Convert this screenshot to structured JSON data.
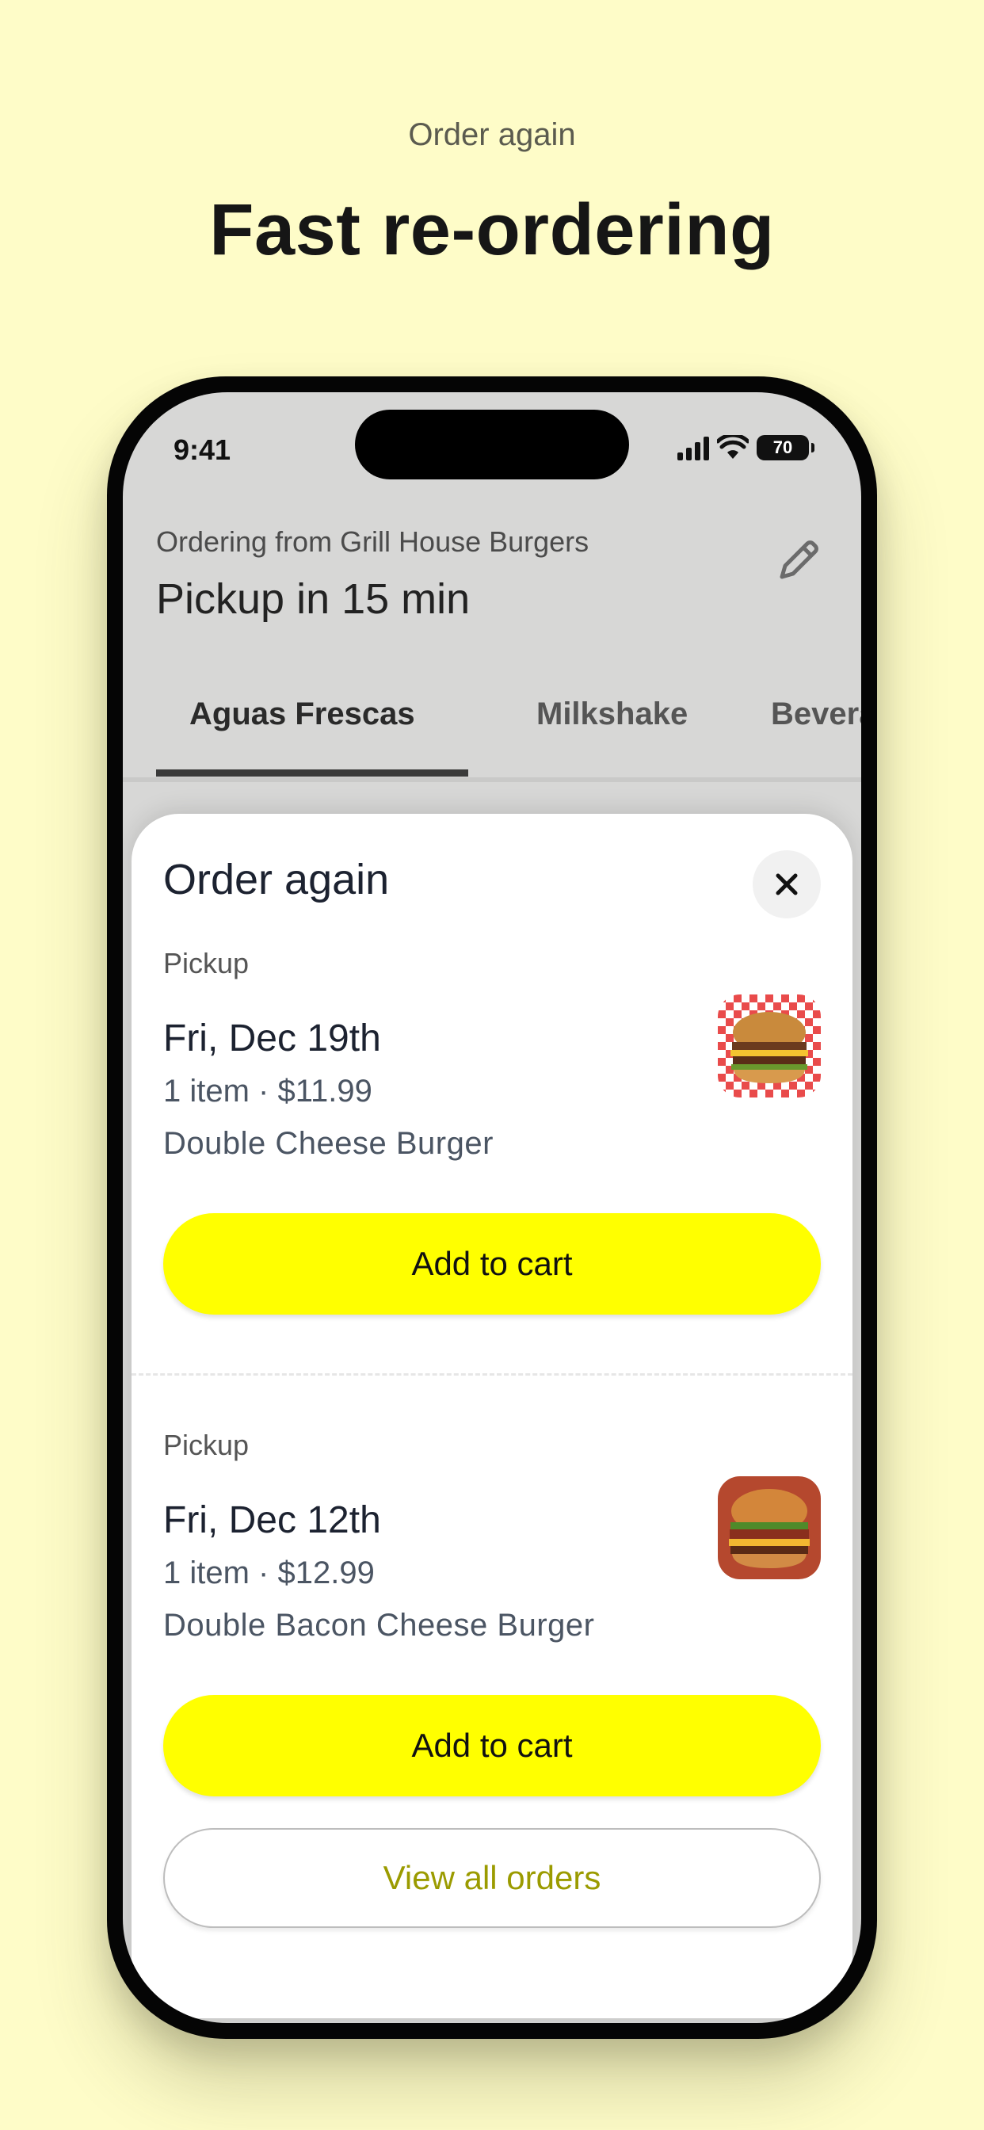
{
  "page": {
    "eyebrow": "Order again",
    "headline": "Fast re-ordering"
  },
  "status_bar": {
    "time": "9:41",
    "battery": "70",
    "icons": [
      "signal-icon",
      "wifi-icon",
      "battery-icon"
    ]
  },
  "header": {
    "ordering_from": "Ordering from Grill House Burgers",
    "pickup_time": "Pickup in 15 min",
    "edit_icon": "pencil-icon"
  },
  "tabs": [
    {
      "label": "Aguas Frescas",
      "active": true
    },
    {
      "label": "Milkshake",
      "active": false
    },
    {
      "label": "Beverag",
      "active": false
    }
  ],
  "sheet": {
    "title": "Order again",
    "close_icon": "close-icon",
    "orders": [
      {
        "mode": "Pickup",
        "date": "Fri, Dec 19th",
        "summary": "1 item · $11.99",
        "item_name": "Double Cheese Burger",
        "add_label": "Add to cart"
      },
      {
        "mode": "Pickup",
        "date": "Fri, Dec 12th",
        "summary": "1 item · $12.99",
        "item_name": "Double Bacon Cheese Burger",
        "add_label": "Add to cart"
      }
    ],
    "view_all_label": "View all orders"
  },
  "colors": {
    "background": "#fefcc8",
    "accent_button": "#ffff00",
    "link_text": "#9b9b00"
  }
}
